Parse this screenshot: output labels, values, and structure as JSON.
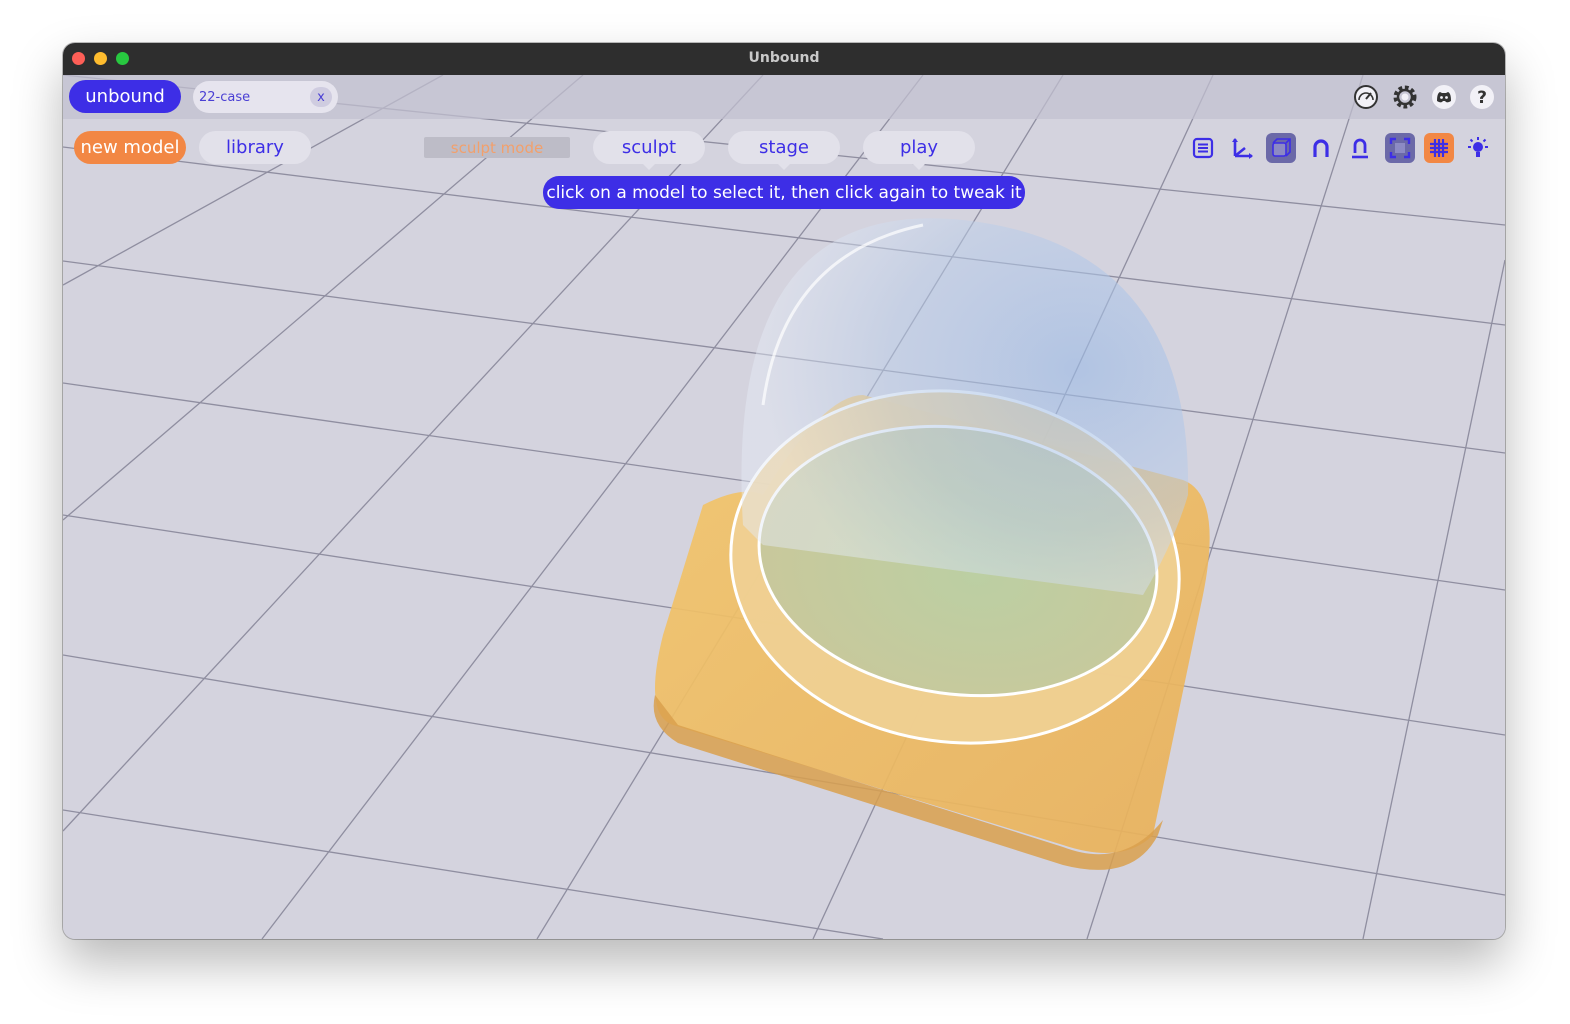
{
  "window": {
    "title": "Unbound"
  },
  "topbar": {
    "app_label": "unbound",
    "document_tab": {
      "label": "22-case",
      "close_label": "x"
    },
    "icons": [
      "speedometer-icon",
      "settings-gear-icon",
      "discord-icon",
      "help-icon"
    ]
  },
  "toolbar": {
    "new_model_label": "new model",
    "library_label": "library",
    "mode_label": "sculpt mode",
    "tabs": [
      {
        "label": "sculpt"
      },
      {
        "label": "stage"
      },
      {
        "label": "play"
      }
    ],
    "right_icons": [
      "list-panel-icon",
      "axes-icon",
      "cube-view-icon",
      "magnet-snap-icon",
      "magnet-person-icon",
      "frame-bounds-icon",
      "grid-icon",
      "light-icon"
    ]
  },
  "hint": {
    "text": "click on a model to select it, then click again to tweak it"
  },
  "colors": {
    "accent": "#3d2ee6",
    "orange": "#f28744",
    "grid_background": "#d4d3de",
    "model_base": "#eab65c",
    "dome": "#a9c3e6"
  }
}
